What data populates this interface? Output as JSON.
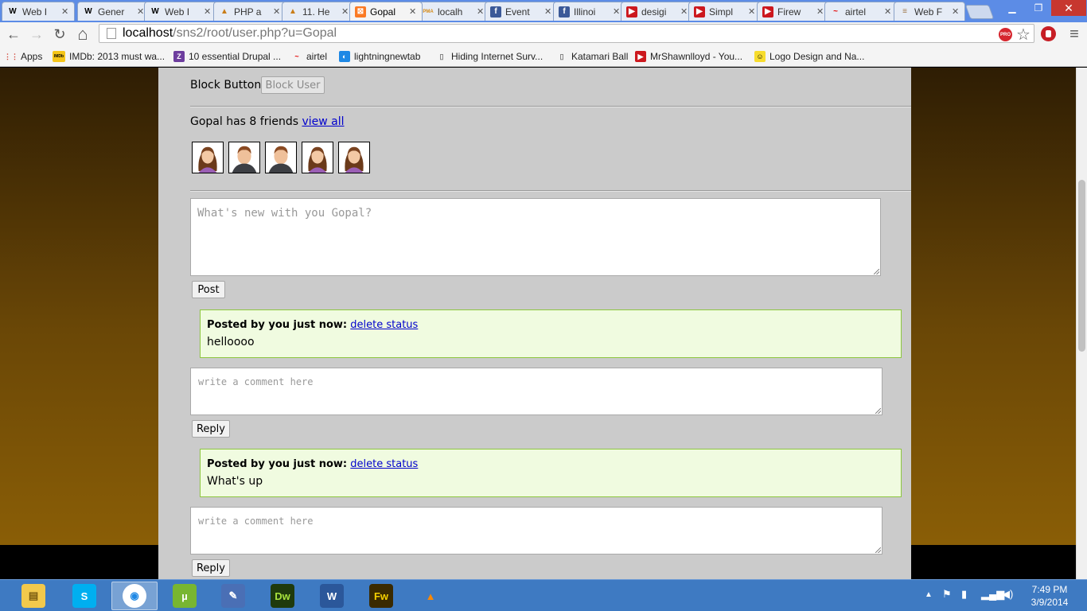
{
  "browser": {
    "tabs": [
      {
        "title": "Web I",
        "icon": "wikipedia-icon",
        "glyph": "W",
        "fg": "#000000",
        "bg": "transparent"
      },
      {
        "title": "Gener",
        "icon": "wikipedia-icon",
        "glyph": "W",
        "fg": "#000000",
        "bg": "transparent"
      },
      {
        "title": "Web I",
        "icon": "wikipedia-icon",
        "glyph": "W",
        "fg": "#000000",
        "bg": "transparent"
      },
      {
        "title": "PHP a",
        "icon": "udemy-icon",
        "glyph": "▲",
        "fg": "#c97d18",
        "bg": "transparent"
      },
      {
        "title": "11. He",
        "icon": "udemy-icon",
        "glyph": "▲",
        "fg": "#c97d18",
        "bg": "transparent"
      },
      {
        "title": "Gopal",
        "icon": "xampp-icon",
        "glyph": "⊠",
        "fg": "#ffffff",
        "bg": "#fb7a24"
      },
      {
        "title": "localh",
        "icon": "phpmyadmin-icon",
        "glyph": "PMA",
        "fg": "#d48a16",
        "bg": "transparent"
      },
      {
        "title": "Event",
        "icon": "facebook-icon",
        "glyph": "f",
        "fg": "#ffffff",
        "bg": "#3b5998"
      },
      {
        "title": "Illinoi",
        "icon": "facebook-icon",
        "glyph": "f",
        "fg": "#ffffff",
        "bg": "#3b5998"
      },
      {
        "title": "desigi",
        "icon": "youtube-icon",
        "glyph": "▶",
        "fg": "#ffffff",
        "bg": "#cc181e"
      },
      {
        "title": "Simpl",
        "icon": "youtube-icon",
        "glyph": "▶",
        "fg": "#ffffff",
        "bg": "#cc181e"
      },
      {
        "title": "Firew",
        "icon": "youtube-icon",
        "glyph": "▶",
        "fg": "#ffffff",
        "bg": "#cc181e"
      },
      {
        "title": "airtel",
        "icon": "airtel-icon",
        "glyph": "~",
        "fg": "#e40000",
        "bg": "transparent"
      },
      {
        "title": "Web F",
        "icon": "stackoverflow-icon",
        "glyph": "≡",
        "fg": "#a0784a",
        "bg": "transparent"
      }
    ],
    "active_tab": 5,
    "url_host": "localhost",
    "url_path": "/sns2/root/user.php?u=Gopal",
    "nav": {
      "back": "←",
      "forward": "→",
      "reload": "↻",
      "home": "⌂",
      "star": "☆",
      "menu": "≡"
    },
    "pro_badge": "PRO",
    "bookmarks": [
      {
        "label": "Apps",
        "icon": "apps-grid-icon",
        "glyph": "⋮⋮",
        "fg": "#d23f31",
        "bg": "transparent"
      },
      {
        "label": "IMDb: 2013 must wa...",
        "icon": "imdb-icon",
        "glyph": "IMDb",
        "fg": "#000000",
        "bg": "#f5c518"
      },
      {
        "label": "10 essential Drupal ...",
        "icon": "z-site-icon",
        "glyph": "Z",
        "fg": "#ffffff",
        "bg": "#6d3d9e"
      },
      {
        "label": "airtel",
        "icon": "airtel-icon",
        "glyph": "~",
        "fg": "#e40000",
        "bg": "transparent"
      },
      {
        "label": "lightningnewtab",
        "icon": "lightning-icon",
        "glyph": "◐",
        "fg": "#ffffff",
        "bg": "#1e88e5"
      },
      {
        "label": "Hiding Internet Surv...",
        "icon": "page-icon",
        "glyph": "▯",
        "fg": "#777777",
        "bg": "transparent"
      },
      {
        "label": "Katamari Ball",
        "icon": "page-icon",
        "glyph": "▯",
        "fg": "#777777",
        "bg": "transparent"
      },
      {
        "label": "MrShawnlloyd - You...",
        "icon": "youtube-icon",
        "glyph": "▶",
        "fg": "#ffffff",
        "bg": "#cc181e"
      },
      {
        "label": "Logo Design and Na...",
        "icon": "smiley-icon",
        "glyph": "☺",
        "fg": "#000000",
        "bg": "#f7dc2d"
      }
    ]
  },
  "profile": {
    "block_label": "Block Button:",
    "block_button": "Block User",
    "friends_text": "Gopal has 8 friends",
    "view_all": "view all",
    "friend_avatars": [
      {
        "gender": "female"
      },
      {
        "gender": "male"
      },
      {
        "gender": "male"
      },
      {
        "gender": "female"
      },
      {
        "gender": "female"
      }
    ],
    "status_placeholder": "What's new with you Gopal?",
    "post_button": "Post"
  },
  "statuses": [
    {
      "meta": "Posted by you just now:",
      "delete": "delete status",
      "text": "helloooo",
      "comment_placeholder": "write a comment here",
      "reply": "Reply"
    },
    {
      "meta": "Posted by you just now:",
      "delete": "delete status",
      "text": "What's up",
      "comment_placeholder": "write a comment here",
      "reply": "Reply"
    }
  ],
  "taskbar": {
    "apps": [
      {
        "name": "file-explorer-icon",
        "glyph": "▤",
        "fg": "#7a5b10",
        "bg": "#f2c94c"
      },
      {
        "name": "skype-icon",
        "glyph": "S",
        "fg": "#ffffff",
        "bg": "#00aff0"
      },
      {
        "name": "chrome-icon",
        "glyph": "◉",
        "fg": "#1e88e5",
        "bg": "#ffffff"
      },
      {
        "name": "utorrent-icon",
        "glyph": "µ",
        "fg": "#ffffff",
        "bg": "#78b631"
      },
      {
        "name": "paint-icon",
        "glyph": "✎",
        "fg": "#ffffff",
        "bg": "#4a6fb5"
      },
      {
        "name": "dreamweaver-icon",
        "glyph": "Dw",
        "fg": "#a8e23d",
        "bg": "#1f3a0c"
      },
      {
        "name": "word-icon",
        "glyph": "W",
        "fg": "#ffffff",
        "bg": "#2b579a"
      },
      {
        "name": "fireworks-icon",
        "glyph": "Fw",
        "fg": "#f5d000",
        "bg": "#3a2a00"
      },
      {
        "name": "vlc-icon",
        "glyph": "▲",
        "fg": "#ff8800",
        "bg": "transparent"
      }
    ],
    "active_app": 2,
    "time": "7:49 PM",
    "date": "3/9/2014"
  }
}
